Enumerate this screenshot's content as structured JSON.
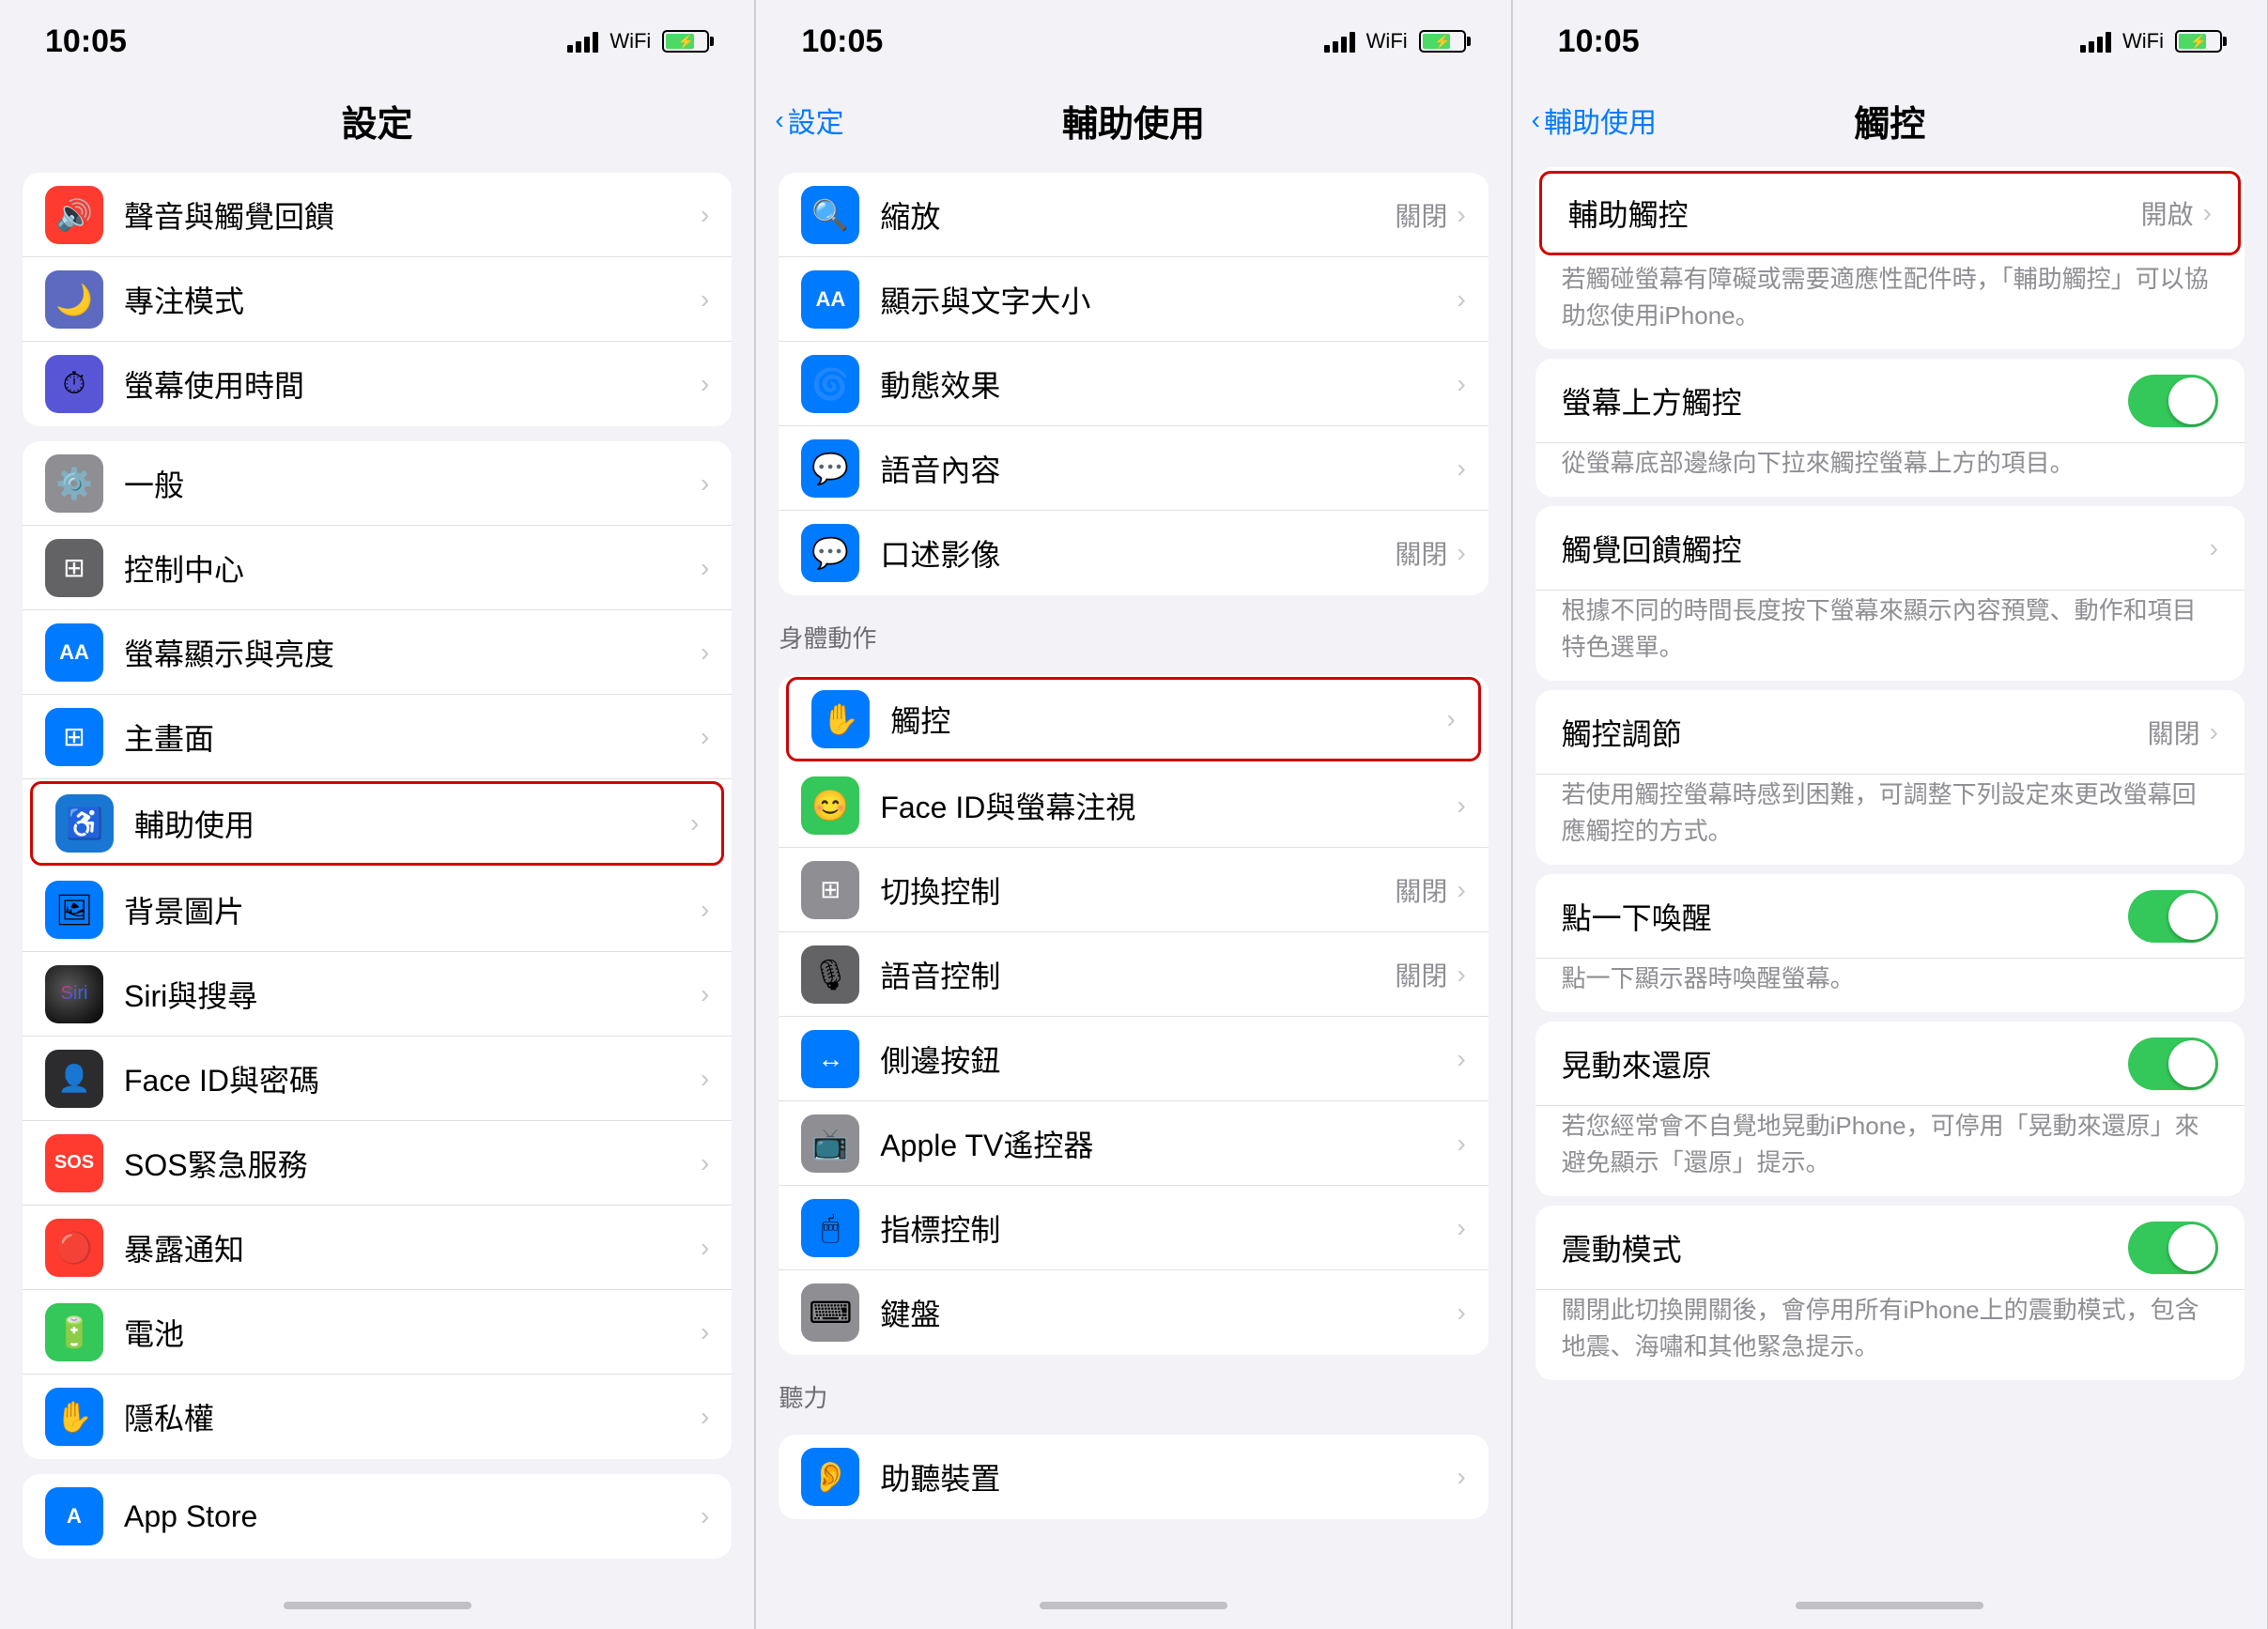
{
  "panel1": {
    "statusBar": {
      "time": "10:05",
      "battery": "charging"
    },
    "title": "設定",
    "sections": [
      {
        "rows": [
          {
            "icon": "🔊",
            "bg": "bg-red",
            "label": "聲音與觸覺回饋",
            "value": "",
            "id": "sound"
          },
          {
            "icon": "🌙",
            "bg": "bg-indigo",
            "label": "專注模式",
            "value": "",
            "id": "focus"
          },
          {
            "icon": "⏱",
            "bg": "bg-purple",
            "label": "螢幕使用時間",
            "value": "",
            "id": "screen-time"
          }
        ]
      },
      {
        "rows": [
          {
            "icon": "⚙️",
            "bg": "bg-gray",
            "label": "一般",
            "value": "",
            "id": "general"
          },
          {
            "icon": "🎛",
            "bg": "bg-gray",
            "label": "控制中心",
            "value": "",
            "id": "control-center"
          },
          {
            "icon": "AA",
            "bg": "bg-blue",
            "label": "螢幕顯示與亮度",
            "value": "",
            "id": "display",
            "isText": true
          },
          {
            "icon": "⊞",
            "bg": "bg-blue",
            "label": "主畫面",
            "value": "",
            "id": "home"
          },
          {
            "icon": "♿",
            "bg": "bg-accessibility",
            "label": "輔助使用",
            "value": "",
            "id": "accessibility",
            "highlighted": true
          },
          {
            "icon": "🖼",
            "bg": "bg-blue",
            "label": "背景圖片",
            "value": "",
            "id": "wallpaper"
          },
          {
            "icon": "🎙",
            "bg": "bg-dark-gray",
            "label": "Siri與搜尋",
            "value": "",
            "id": "siri"
          },
          {
            "icon": "👤",
            "bg": "bg-green",
            "label": "Face ID與密碼",
            "value": "",
            "id": "faceid"
          },
          {
            "icon": "SOS",
            "bg": "bg-red",
            "label": "SOS緊急服務",
            "value": "",
            "id": "sos",
            "isText": true
          },
          {
            "icon": "🔴",
            "bg": "bg-red",
            "label": "暴露通知",
            "value": "",
            "id": "exposure"
          },
          {
            "icon": "🔋",
            "bg": "bg-green",
            "label": "電池",
            "value": "",
            "id": "battery"
          },
          {
            "icon": "✋",
            "bg": "bg-blue",
            "label": "隱私權",
            "value": "",
            "id": "privacy"
          }
        ]
      },
      {
        "rows": [
          {
            "icon": "A",
            "bg": "bg-blue",
            "label": "App Store",
            "value": "",
            "id": "appstore",
            "isText": true
          }
        ]
      }
    ]
  },
  "panel2": {
    "statusBar": {
      "time": "10:05"
    },
    "backLabel": "設定",
    "title": "輔助使用",
    "sections": [
      {
        "rows": [
          {
            "icon": "🔍",
            "bg": "bg-blue",
            "label": "縮放",
            "value": "關閉",
            "id": "zoom"
          },
          {
            "icon": "AA",
            "bg": "bg-blue",
            "label": "顯示與文字大小",
            "value": "",
            "id": "display-text",
            "isText": true
          },
          {
            "icon": "🌀",
            "bg": "bg-blue",
            "label": "動態效果",
            "value": "",
            "id": "motion"
          },
          {
            "icon": "💬",
            "bg": "bg-blue",
            "label": "語音內容",
            "value": "",
            "id": "spoken"
          },
          {
            "icon": "💬",
            "bg": "bg-blue",
            "label": "口述影像",
            "value": "關閉",
            "id": "audio-desc"
          }
        ]
      },
      {
        "sectionLabel": "身體動作",
        "rows": [
          {
            "icon": "✋",
            "bg": "bg-blue",
            "label": "觸控",
            "value": "",
            "id": "touch",
            "highlighted": true
          },
          {
            "icon": "😊",
            "bg": "bg-green",
            "label": "Face ID與螢幕注視",
            "value": "",
            "id": "faceid-gaze"
          },
          {
            "icon": "⊞",
            "bg": "bg-gray",
            "label": "切換控制",
            "value": "關閉",
            "id": "switch-control"
          },
          {
            "icon": "🎙",
            "bg": "bg-dark-gray",
            "label": "語音控制",
            "value": "關閉",
            "id": "voice-control"
          },
          {
            "icon": "↔",
            "bg": "bg-blue",
            "label": "側邊按鈕",
            "value": "",
            "id": "side-button"
          },
          {
            "icon": "📺",
            "bg": "bg-gray",
            "label": "Apple TV遙控器",
            "value": "",
            "id": "apple-tv"
          },
          {
            "icon": "🖱",
            "bg": "bg-blue",
            "label": "指標控制",
            "value": "",
            "id": "pointer"
          },
          {
            "icon": "⌨",
            "bg": "bg-gray",
            "label": "鍵盤",
            "value": "",
            "id": "keyboard"
          }
        ]
      },
      {
        "sectionLabel": "聽力",
        "rows": [
          {
            "icon": "👂",
            "bg": "bg-blue",
            "label": "助聽裝置",
            "value": "",
            "id": "hearing"
          }
        ]
      }
    ]
  },
  "panel3": {
    "statusBar": {
      "time": "10:05"
    },
    "backLabel": "輔助使用",
    "title": "觸控",
    "rows": [
      {
        "id": "assistive-touch",
        "label": "輔助觸控",
        "value": "開啟",
        "highlighted": true,
        "desc": "若觸碰螢幕有障礙或需要適應性配件時，「輔助觸控」可以協助您使用iPhone。"
      },
      {
        "id": "top-touch",
        "label": "螢幕上方觸控",
        "toggle": "on",
        "desc": "從螢幕底部邊緣向下拉來觸控螢幕上方的項目。"
      },
      {
        "id": "haptic-touch",
        "label": "觸覺回饋觸控",
        "value": "",
        "desc": "根據不同的時間長度按下螢幕來顯示內容預覽、動作和項目特色選單。"
      },
      {
        "id": "touch-accommodations",
        "label": "觸控調節",
        "value": "關閉",
        "desc": "若使用觸控螢幕時感到困難，可調整下列設定來更改螢幕回應觸控的方式。"
      },
      {
        "id": "tap-to-wake",
        "label": "點一下喚醒",
        "toggle": "on",
        "desc": "點一下顯示器時喚醒螢幕。"
      },
      {
        "id": "shake-to-undo",
        "label": "晃動來還原",
        "toggle": "on",
        "desc": "若您經常會不自覺地晃動iPhone，可停用「晃動來還原」來避免顯示「還原」提示。"
      },
      {
        "id": "vibration",
        "label": "震動模式",
        "toggle": "on",
        "desc": "關閉此切換開關後，會停用所有iPhone上的震動模式，包含地震、海嘯和其他緊急提示。"
      }
    ]
  },
  "icons": {
    "chevron": "›",
    "back": "‹"
  }
}
